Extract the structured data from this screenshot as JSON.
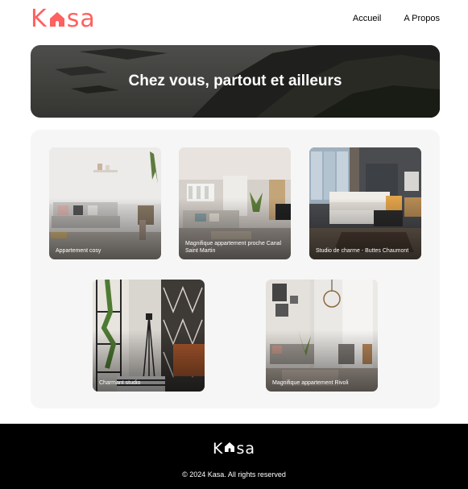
{
  "header": {
    "logo": {
      "prefix": "K",
      "suffix": "sa",
      "color": "#FF6060",
      "icon": "house-icon"
    },
    "nav": [
      {
        "label": "Accueil"
      },
      {
        "label": "A Propos"
      }
    ]
  },
  "banner": {
    "title": "Chez vous, partout et ailleurs"
  },
  "gallery": {
    "cards": [
      {
        "title": "Appartement cosy"
      },
      {
        "title": "Magnifique appartement proche Canal Saint Martin"
      },
      {
        "title": "Studio de charme - Buttes Chaumont"
      },
      {
        "title": "Charmant studio"
      },
      {
        "title": "Magnifique appartement Rivoli"
      }
    ]
  },
  "footer": {
    "logo": {
      "prefix": "K",
      "suffix": "sa",
      "color": "#FFFFFF",
      "icon": "house-icon"
    },
    "copyright": "© 2024 Kasa. All rights reserved"
  }
}
